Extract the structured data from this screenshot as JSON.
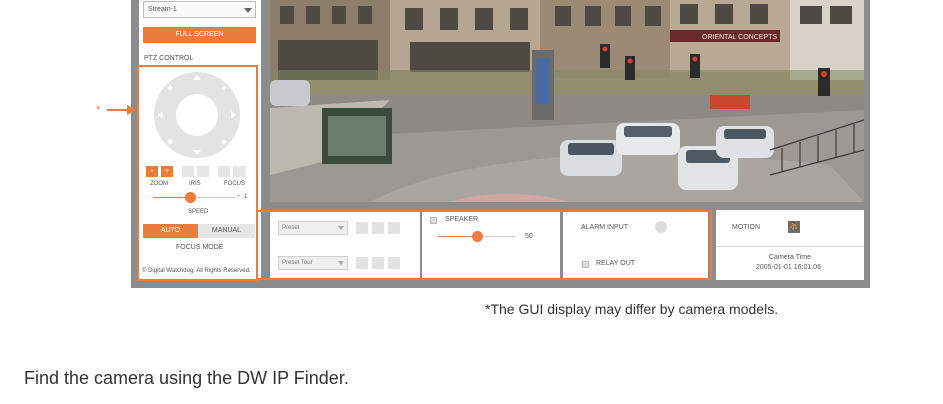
{
  "left_panel": {
    "stream_select": "Stream-1",
    "fullscreen_label": "FULL SCREEN",
    "ptz_control_label": "PTZ CONTROL",
    "zoom_minus": "-",
    "zoom_plus": "+",
    "zoom_label": "ZOOM",
    "iris_label": "IRIS",
    "focus_label": "FOCUS",
    "speed_minus": "-",
    "speed_plus": "+",
    "speed_value": "1",
    "speed_level": 0.45,
    "speed_label": "SPEED",
    "auto_label": "AUTO",
    "manual_label": "MANUAL",
    "focus_mode_label": "FOCUS MODE",
    "copyright": "© Digital Watchdog. All Rights Reserved."
  },
  "bottom": {
    "preset_select": "Preset",
    "preset_tour_select": "Preset Tour",
    "speaker_label": "SPEAKER",
    "speaker_value": "50",
    "speaker_level": 0.5,
    "alarm_input_label": "ALARM INPUT",
    "relay_out_label": "RELAY OUT",
    "motion_label": "MOTION",
    "camera_time_label": "Camera Time",
    "camera_time_value": "2005-01-01 16:01:06"
  },
  "video": {
    "sign_text": "ORIENTAL CONCEPTS"
  },
  "callout_marker": "*",
  "caption": "*The GUI display may differ by camera models.",
  "instruction": "Find the camera using the DW IP Finder.",
  "colors": {
    "accent": "#ec7c3b",
    "frame": "#8c8c8c"
  }
}
